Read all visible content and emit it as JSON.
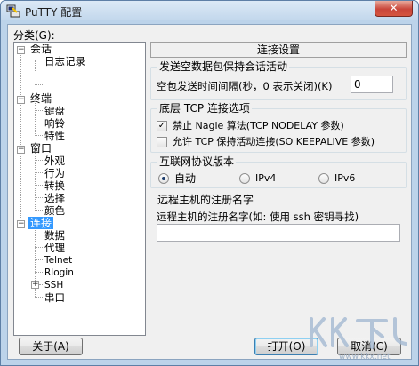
{
  "window": {
    "title": "PuTTY 配置",
    "close_glyph": "✕"
  },
  "category_label": "分类(G):",
  "tree": {
    "items": [
      {
        "label": "会话",
        "expander": "−"
      },
      {
        "label": "日志记录"
      },
      {
        "label": "终端",
        "expander": "−"
      },
      {
        "label": "键盘"
      },
      {
        "label": "响铃"
      },
      {
        "label": "特性"
      },
      {
        "label": "窗口",
        "expander": "−"
      },
      {
        "label": "外观"
      },
      {
        "label": "行为"
      },
      {
        "label": "转换"
      },
      {
        "label": "选择"
      },
      {
        "label": "颜色"
      },
      {
        "label": "连接",
        "expander": "−",
        "selected": true
      },
      {
        "label": "数据"
      },
      {
        "label": "代理"
      },
      {
        "label": "Telnet"
      },
      {
        "label": "Rlogin"
      },
      {
        "label": "SSH",
        "expander": "+"
      },
      {
        "label": "串口"
      }
    ]
  },
  "panel": {
    "header": "连接设置",
    "keepalive": {
      "title": "发送空数据包保持会话活动",
      "label": "空包发送时间间隔(秒，0 表示关闭)(K)",
      "value": "0"
    },
    "tcp": {
      "title": "底层 TCP 连接选项",
      "options": [
        {
          "label": "禁止 Nagle 算法(TCP NODELAY 参数)",
          "checked": true,
          "mark": "✓"
        },
        {
          "label": "允许 TCP 保持活动连接(SO KEEPALIVE 参数)",
          "checked": false,
          "mark": ""
        }
      ]
    },
    "protocol": {
      "title": "互联网协议版本",
      "options": [
        {
          "label": "自动",
          "selected": true
        },
        {
          "label": "IPv4",
          "selected": false
        },
        {
          "label": "IPv6",
          "selected": false
        }
      ]
    },
    "remote": {
      "title": "远程主机的注册名字",
      "label": "远程主机的注册名字(如: 使用 ssh 密钥寻找)",
      "value": ""
    }
  },
  "buttons": {
    "about": "关于(A)",
    "open": "打开(O)",
    "cancel": "取消(C)"
  },
  "watermark": {
    "text": "KK下载",
    "url": "www.kkx.net",
    "color": "#a9bdd4"
  }
}
